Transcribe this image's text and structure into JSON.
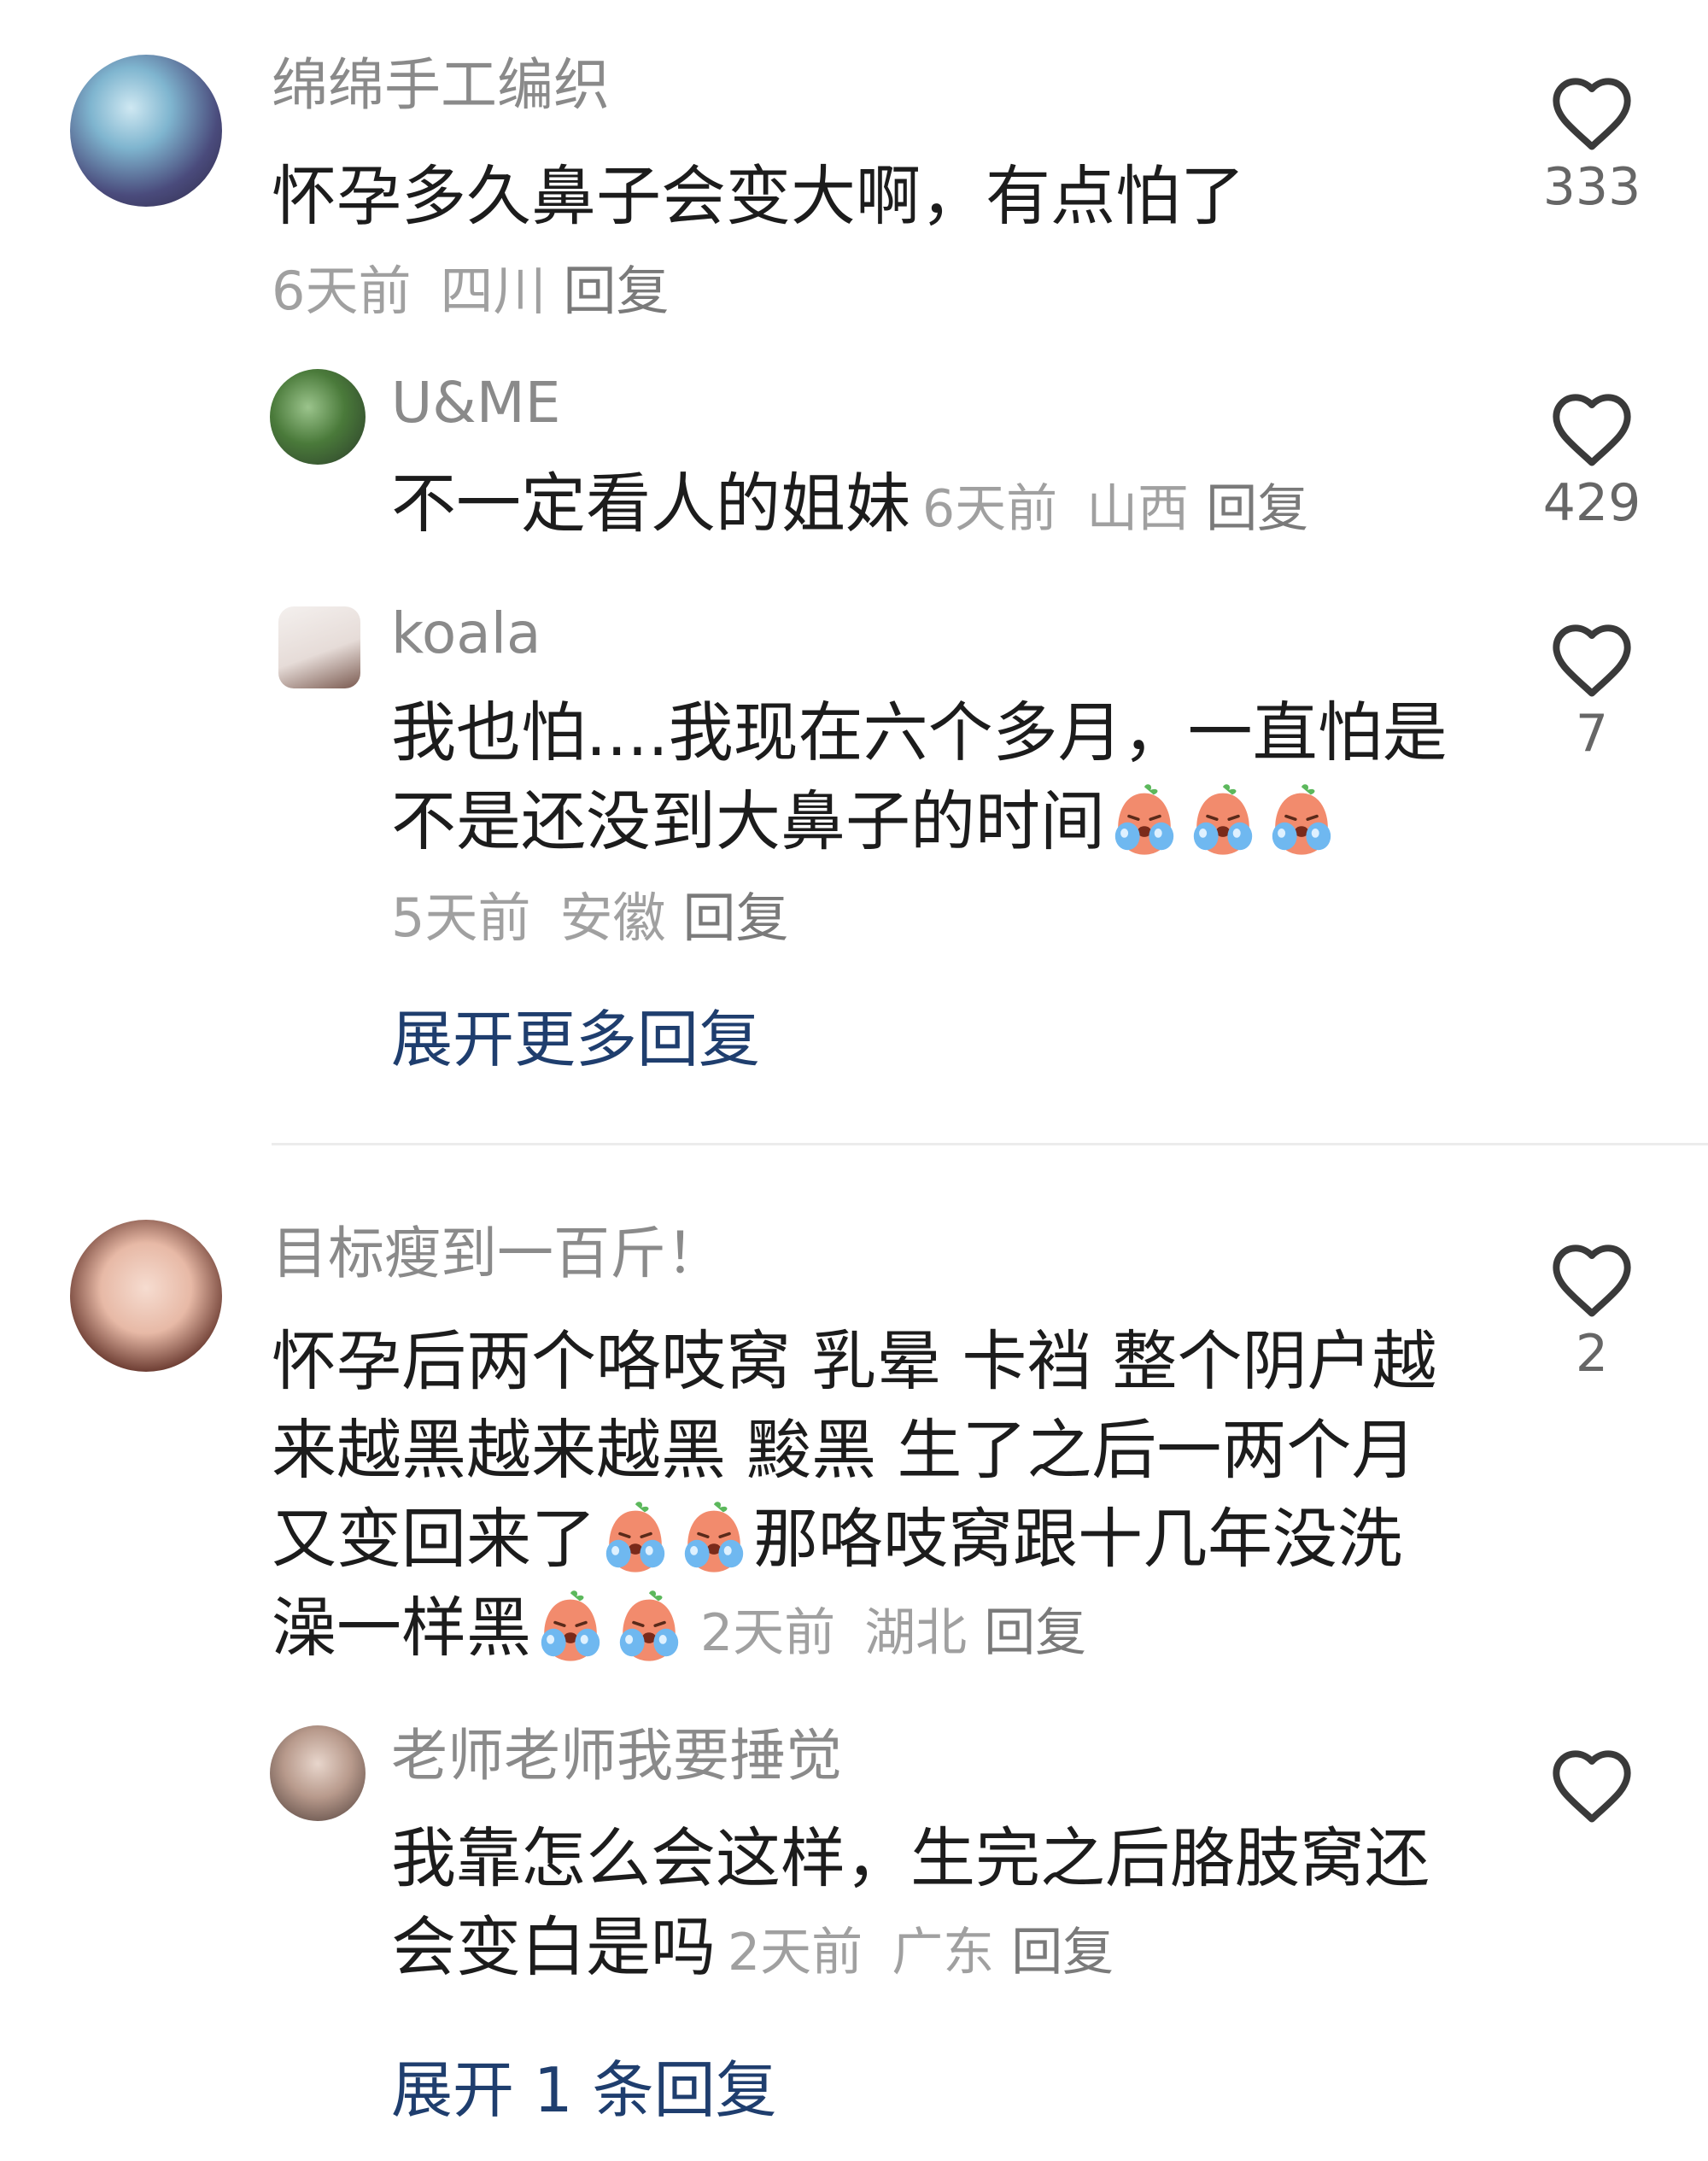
{
  "comments": [
    {
      "author": "绵绵手工编织",
      "text": "怀孕多久鼻子会变大啊，有点怕了",
      "time": "6天前",
      "location": "四川",
      "reply_label": "回复",
      "likes": "333",
      "replies": [
        {
          "author": "U&ME",
          "text": "不一定看人的姐妹",
          "time": "6天前",
          "location": "山西",
          "reply_label": "回复",
          "likes": "429"
        },
        {
          "author": "koala",
          "text_line1": "我也怕....我现在六个多月，一直怕是",
          "text_line2": "不是还没到大鼻子的时间",
          "emoji": "crying-face-emoji",
          "time": "5天前",
          "location": "安徽",
          "reply_label": "回复",
          "likes": "7"
        }
      ],
      "expand_label": "展开更多回复"
    },
    {
      "author": "目标瘦到一百斤！",
      "text_line1": "怀孕后两个咯吱窝 乳晕 卡裆 整个阴户越",
      "text_line2": "来越黑越来越黑 黢黑 生了之后一两个月",
      "text_line3a": "又变回来了",
      "text_line3b": "那咯吱窝跟十几年没洗",
      "text_line4": "澡一样黑",
      "emoji": "crying-face-emoji",
      "time": "2天前",
      "location": "湖北",
      "reply_label": "回复",
      "likes": "2",
      "replies": [
        {
          "author": "老师老师我要捶觉",
          "text_line1": "我靠怎么会这样，生完之后胳肢窝还",
          "text_line2": "会变白是吗",
          "time": "2天前",
          "location": "广东",
          "reply_label": "回复",
          "likes": ""
        }
      ],
      "expand_label": "展开 1 条回复"
    }
  ],
  "colors": {
    "accent_link": "#1f3e6e",
    "meta_gray": "#a0a0a0",
    "text": "#1c1c1c"
  }
}
